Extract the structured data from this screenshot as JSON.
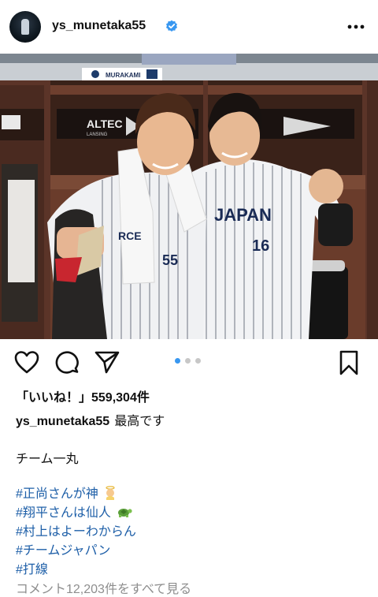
{
  "header": {
    "username": "ys_munetaka55",
    "verified_icon": "verified-badge-icon",
    "more_icon": "more-horizontal-icon"
  },
  "photo": {
    "locker_nameplate": "MURAKAMI",
    "speaker_brand_left": "ALTEC",
    "speaker_brand_left_sub": "LANSING",
    "jersey_right_text": "JAPAN",
    "jersey_right_number": "16",
    "jersey_left_number": "55",
    "towel_text": "RCE"
  },
  "actions": {
    "like_icon": "heart-icon",
    "comment_icon": "comment-icon",
    "share_icon": "send-icon",
    "save_icon": "bookmark-icon",
    "carousel_dots": 3,
    "carousel_active_index": 0,
    "accent_color": "#3897f0"
  },
  "likes": {
    "label": "「いいね！」559,304件"
  },
  "caption": {
    "username": "ys_munetaka55",
    "text": "最高です",
    "line2": "チーム一丸",
    "hashtags": [
      {
        "text": "#正尚さんが神",
        "emoji": "angel"
      },
      {
        "text": "#翔平さんは仙人",
        "emoji": "turtle"
      },
      {
        "text": "#村上はよーわからん",
        "emoji": ""
      },
      {
        "text": "#チームジャパン",
        "emoji": ""
      },
      {
        "text": "#打線",
        "emoji": ""
      }
    ]
  },
  "comments": {
    "view_all_label": "コメント12,203件をすべて見る"
  }
}
